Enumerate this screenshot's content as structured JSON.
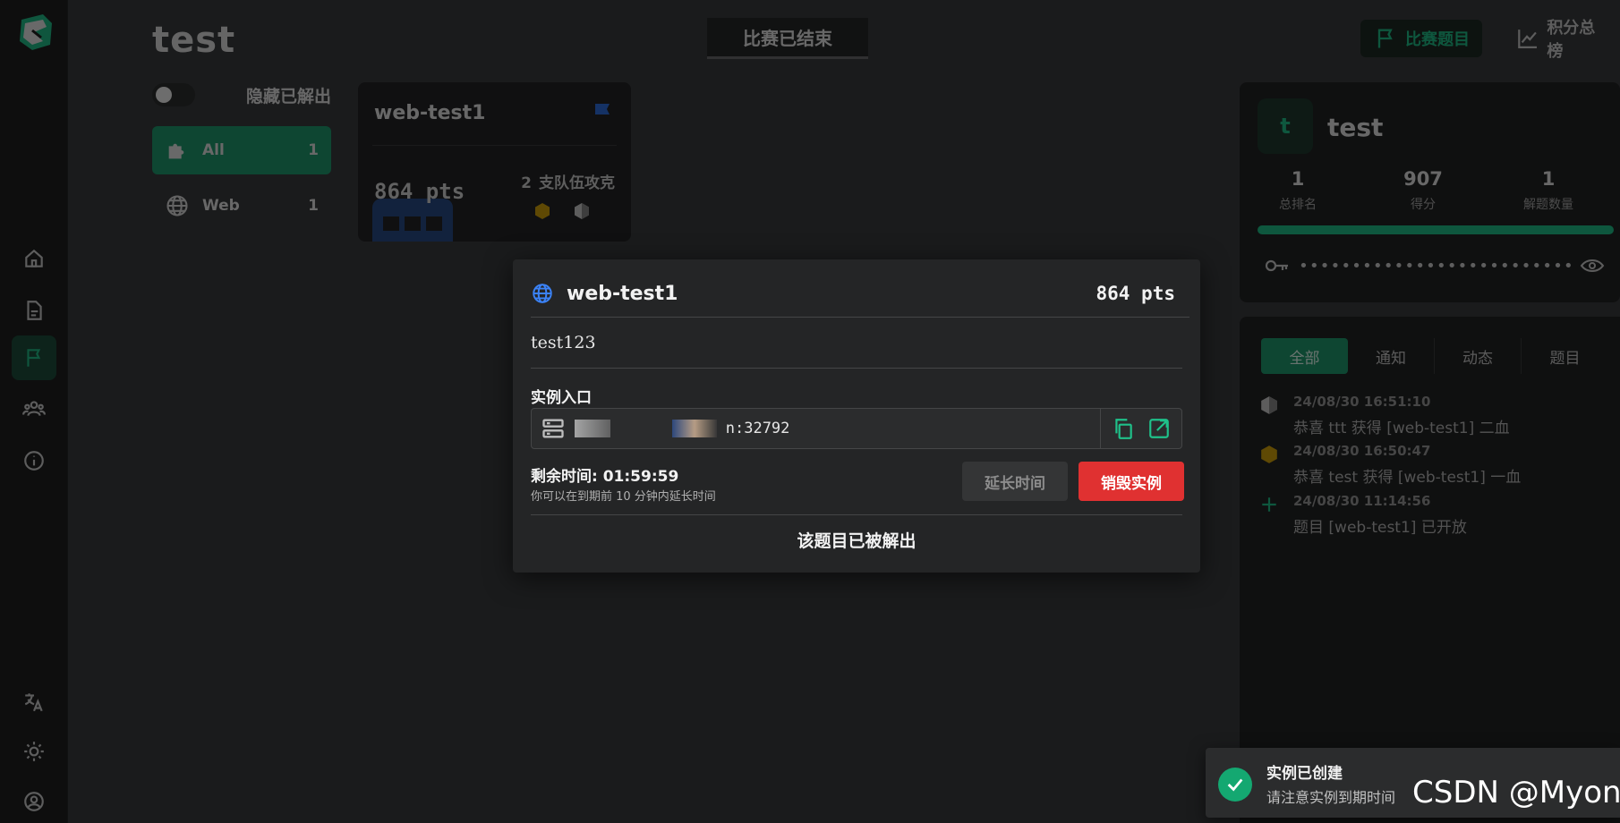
{
  "app": {
    "title": "test",
    "status_tab": "比赛已结束"
  },
  "header": {
    "challenges_label": "比赛题目",
    "scoreboard_label": "积分总榜"
  },
  "filter": {
    "hide_solved_label": "隐藏已解出",
    "hide_solved_on": false
  },
  "categories": [
    {
      "label": "All",
      "count": "1",
      "icon": "puzzle-icon"
    },
    {
      "label": "Web",
      "count": "1",
      "icon": "globe-icon"
    }
  ],
  "challenge_card": {
    "title": "web-test1",
    "points": "864 pts",
    "solves": "2",
    "solves_label": "支队伍攻克"
  },
  "team": {
    "avatar_letter": "t",
    "name": "test",
    "rank": "1",
    "rank_label": "总排名",
    "score": "907",
    "score_label": "得分",
    "solved": "1",
    "solved_label": "解题数量",
    "progress": 1.0,
    "token_mask": "••••••••••••••••••••••••••••••••••••••••"
  },
  "events": {
    "tabs": [
      "全部",
      "通知",
      "动态",
      "题目"
    ],
    "items": [
      {
        "time": "24/08/30 16:51:10",
        "message": "恭喜 ttt 获得 [web-test1] 二血",
        "icon": "second-blood-icon"
      },
      {
        "time": "24/08/30 16:50:47",
        "message": "恭喜 test 获得 [web-test1] 一血",
        "icon": "first-blood-icon"
      },
      {
        "time": "24/08/30 11:14:56",
        "message": "题目 [web-test1] 已开放",
        "icon": "plus-icon"
      }
    ]
  },
  "modal": {
    "title": "web-test1",
    "points": "864 pts",
    "description": "test123",
    "entry_label": "实例入口",
    "entry_address_suffix": "n:32792",
    "remaining_label": "剩余时间: 01:59:59",
    "extend_hint": "你可以在到期前 10 分钟内延长时间",
    "extend_button": "延长时间",
    "destroy_button": "销毁实例",
    "solved_text": "该题目已被解出"
  },
  "toast": {
    "title": "实例已创建",
    "message": "请注意实例到期时间"
  },
  "watermark": "CSDN @Myon",
  "colors": {
    "accent": "#1e9b70",
    "danger": "#e03131",
    "background": "#1a1b1c"
  }
}
